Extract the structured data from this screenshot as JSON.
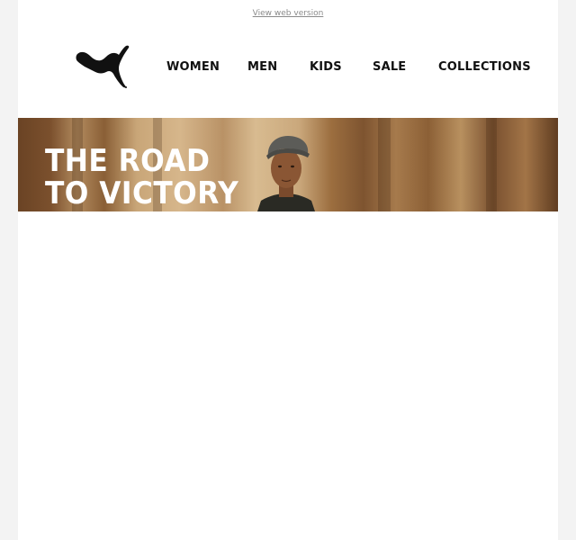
{
  "header": {
    "web_version_link": "View web version"
  },
  "logo": {
    "icon": "puma-cat-logo-icon"
  },
  "nav": {
    "items": [
      {
        "label": "WOMEN"
      },
      {
        "label": "MEN"
      },
      {
        "label": "KIDS"
      },
      {
        "label": "SALE"
      },
      {
        "label": "COLLECTIONS"
      }
    ]
  },
  "hero": {
    "title_line1": "THE ROAD",
    "title_line2": "TO VICTORY"
  },
  "colors": {
    "background": "#f3f3f3",
    "email_background": "#ffffff",
    "nav_text": "#111111",
    "hero_text": "#ffffff"
  }
}
